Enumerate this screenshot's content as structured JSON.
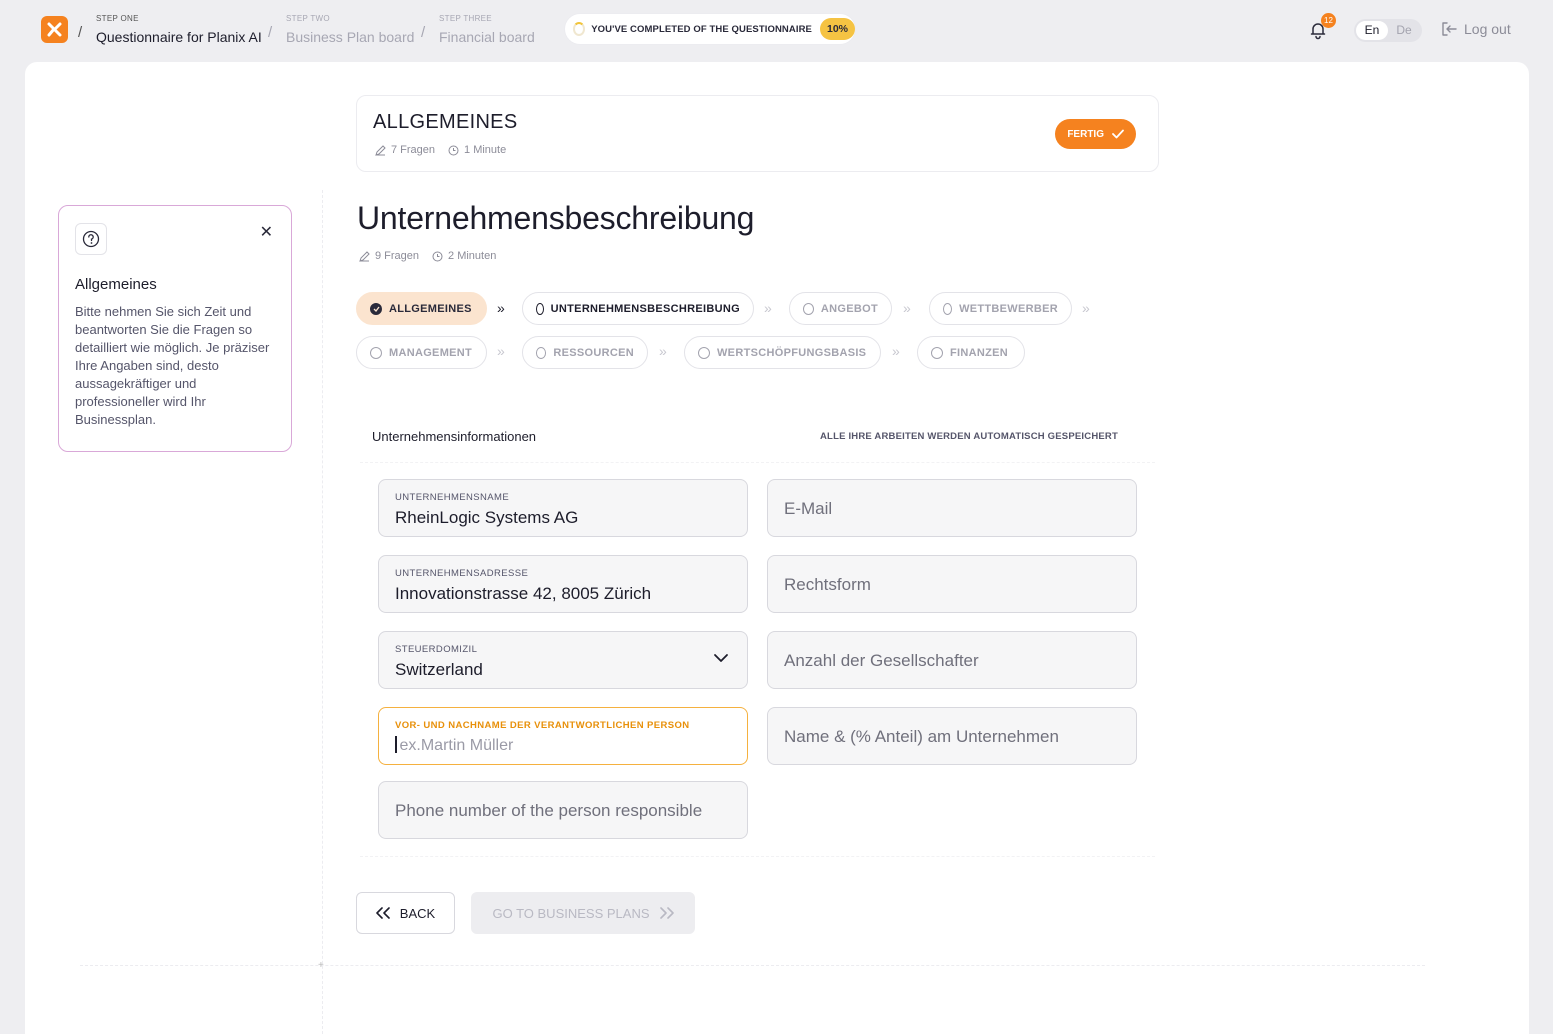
{
  "header": {
    "breadcrumbs": [
      {
        "step": "STEP ONE",
        "name": "Questionnaire for Planix AI"
      },
      {
        "step": "STEP TWO",
        "name": "Business Plan board"
      },
      {
        "step": "STEP THREE",
        "name": "Financial board"
      }
    ],
    "progress_text": "YOU'VE COMPLETED OF THE QUESTIONNAIRE",
    "progress_value": "10%",
    "notification_count": "12",
    "lang_en": "En",
    "lang_de": "De",
    "logout_label": "Log out"
  },
  "section": {
    "title": "ALLGEMEINES",
    "questions": "7 Fragen",
    "duration": "1 Minute",
    "done_label": "FERTIG"
  },
  "page": {
    "title": "Unternehmensbeschreibung",
    "questions": "9 Fragen",
    "duration": "2 Minuten"
  },
  "steps": [
    {
      "label": "ALLGEMEINES",
      "state": "done"
    },
    {
      "label": "UNTERNEHMENSBESCHREIBUNG",
      "state": "current"
    },
    {
      "label": "ANGEBOT",
      "state": "todo"
    },
    {
      "label": "WETTBEWERBER",
      "state": "todo"
    },
    {
      "label": "MANAGEMENT",
      "state": "todo"
    },
    {
      "label": "RESSOURCEN",
      "state": "todo"
    },
    {
      "label": "WERTSCHÖPFUNGSBASIS",
      "state": "todo"
    },
    {
      "label": "FINANZEN",
      "state": "todo"
    }
  ],
  "help": {
    "title": "Allgemeines",
    "body": "Bitte nehmen Sie sich Zeit und beantworten Sie die Fragen so detailliert wie möglich. Je präziser Ihre Angaben sind, desto aussagekräftiger und professioneller wird Ihr Businessplan."
  },
  "form": {
    "title": "Unternehmensinformationen",
    "autosave": "ALLE IHRE ARBEITEN WERDEN AUTOMATISCH GESPEICHERT",
    "company_name_label": "UNTERNEHMENSNAME",
    "company_name_value": "RheinLogic Systems AG",
    "address_label": "UNTERNEHMENSADRESSE",
    "address_value": "Innovationstrasse 42, 8005 Zürich",
    "tax_label": "STEUERDOMIZIL",
    "tax_value": "Switzerland",
    "responsible_label": "VOR- UND NACHNAME DER VERANTWORTLICHEN PERSON",
    "responsible_placeholder": "ex.Martin  Müller",
    "phone_placeholder": "Phone number of the person responsible",
    "email_placeholder": "E-Mail",
    "legal_form_placeholder": "Rechtsform",
    "partners_placeholder": "Anzahl der Gesellschafter",
    "shares_placeholder": "Name & (% Anteil) am Unternehmen"
  },
  "buttons": {
    "back": "BACK",
    "next": "GO TO BUSINESS PLANS"
  },
  "colors": {
    "accent": "#f5821f",
    "progress_badge": "#f5c343",
    "help_border": "#d9a8d8",
    "done_chip": "#fbe4cf"
  }
}
